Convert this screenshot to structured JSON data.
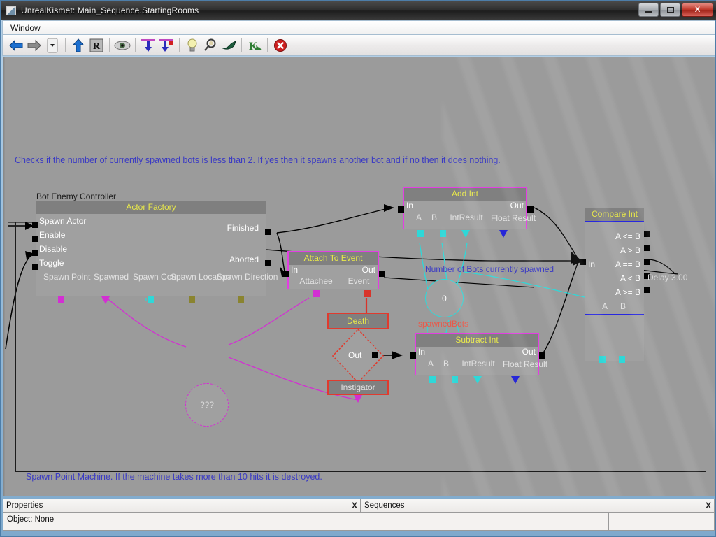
{
  "window": {
    "title": "UnrealKismet: Main_Sequence.StartingRooms",
    "minimize_label": "Minimize",
    "maximize_label": "Maximize",
    "close_label": "X"
  },
  "menubar": {
    "items": [
      {
        "label": "Window"
      }
    ]
  },
  "toolbar": {
    "items": [
      {
        "name": "back-icon",
        "tooltip": "Back"
      },
      {
        "name": "forward-icon",
        "tooltip": "Forward"
      },
      {
        "name": "history-dropdown-icon",
        "tooltip": "History"
      },
      {
        "name": "parent-sequence-icon",
        "tooltip": "Up to Parent Sequence"
      },
      {
        "name": "rename-icon",
        "tooltip": "Rename"
      },
      {
        "name": "hide-connectors-icon",
        "tooltip": "Hide Unused Connectors"
      },
      {
        "name": "show-connectors-icon",
        "tooltip": "Show Connectors"
      },
      {
        "name": "clear-connectors-icon",
        "tooltip": "Clear Connectors"
      },
      {
        "name": "search-actors-icon",
        "tooltip": "Search for Actors"
      },
      {
        "name": "zoom-search-icon",
        "tooltip": "Search"
      },
      {
        "name": "curve-editor-icon",
        "tooltip": "Open Curve Editor"
      },
      {
        "name": "kismet-bookmark-icon",
        "tooltip": "Kismet"
      },
      {
        "name": "delete-icon",
        "tooltip": "Delete"
      }
    ]
  },
  "canvas": {
    "comments": [
      {
        "text": "Checks if the number of currently spawned bots is less than 2. If yes then it spawns another bot and if no then it does nothing."
      },
      {
        "text": "Spawn Point Machine. If the machine takes more than 10 hits it is destroyed."
      }
    ],
    "annotations": [
      {
        "text": "Bot Enemy Controller"
      },
      {
        "text": "Number of Bots currently spawned"
      },
      {
        "text": "Delay 3.00"
      },
      {
        "text": "spawnedBots"
      }
    ]
  },
  "nodes": {
    "actor_factory": {
      "title": "Actor Factory",
      "inputs": [
        "Spawn Actor",
        "Enable",
        "Disable",
        "Toggle"
      ],
      "outputs": [
        "Finished",
        "Aborted"
      ],
      "variables": [
        "Spawn Point",
        "Spawned",
        "Spawn Count",
        "Spawn Location",
        "Spawn Direction"
      ]
    },
    "add_int": {
      "title": "Add Int",
      "inputs": [
        "In"
      ],
      "outputs": [
        "Out"
      ],
      "variables": [
        "A",
        "B",
        "IntResult",
        "Float Result"
      ]
    },
    "subtract_int": {
      "title": "Subtract Int",
      "inputs": [
        "In"
      ],
      "outputs": [
        "Out"
      ],
      "variables": [
        "A",
        "B",
        "IntResult",
        "Float Result"
      ]
    },
    "compare_int": {
      "title": "Compare Int",
      "inputs": [
        "In"
      ],
      "outputs": [
        "A <= B",
        "A > B",
        "A == B",
        "A < B",
        "A >= B"
      ],
      "variables": [
        "A",
        "B"
      ]
    },
    "attach_to_event": {
      "title": "Attach To Event",
      "inputs": [
        "In"
      ],
      "outputs": [
        "Out"
      ],
      "variables": [
        "Attachee",
        "Event"
      ]
    },
    "death_event": {
      "title": "Death",
      "outputs": [
        "Out"
      ],
      "variables": [
        "Instigator"
      ]
    },
    "spawned_bots_var": {
      "value": "0",
      "name": "spawnedBots"
    },
    "unknown_var": {
      "value": "???"
    }
  },
  "panels": {
    "properties": {
      "title": "Properties",
      "close_label": "X",
      "object_label": "Object: None"
    },
    "sequences": {
      "title": "Sequences",
      "close_label": "X"
    }
  }
}
